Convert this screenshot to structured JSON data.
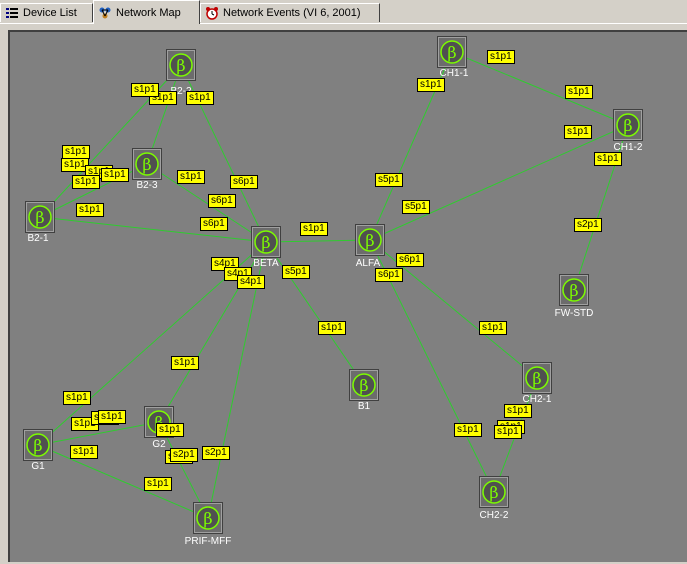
{
  "tabs": [
    {
      "label": "Device List",
      "icon": "list-icon",
      "active": false
    },
    {
      "label": "Network Map",
      "icon": "network-map-icon",
      "active": true
    },
    {
      "label": "Network Events (VI 6, 2001)",
      "icon": "alarm-clock-icon",
      "active": false
    }
  ],
  "colors": {
    "map_bg": "#808080",
    "link": "#2ecc2e",
    "port_bg": "#ffff00",
    "node_glyph": "#7CFC00"
  },
  "nodes": [
    {
      "id": "B2-2",
      "label": "B2-2"
    },
    {
      "id": "B2-3",
      "label": "B2-3"
    },
    {
      "id": "B2-1",
      "label": "B2-1"
    },
    {
      "id": "BETA",
      "label": "BETA"
    },
    {
      "id": "ALFA",
      "label": "ALFA"
    },
    {
      "id": "CH1-1",
      "label": "CH1-1"
    },
    {
      "id": "CH1-2",
      "label": "CH1-2"
    },
    {
      "id": "FW-STD",
      "label": "FW-STD"
    },
    {
      "id": "B1",
      "label": "B1"
    },
    {
      "id": "CH2-1",
      "label": "CH2-1"
    },
    {
      "id": "CH2-2",
      "label": "CH2-2"
    },
    {
      "id": "G1",
      "label": "G1"
    },
    {
      "id": "G2",
      "label": "G2"
    },
    {
      "id": "PRIF-MFF",
      "label": "PRIF-MFF"
    }
  ],
  "links": [
    [
      "B2-2",
      "B2-1"
    ],
    [
      "B2-2",
      "B2-3"
    ],
    [
      "B2-2",
      "BETA"
    ],
    [
      "B2-1",
      "B2-3"
    ],
    [
      "B2-1",
      "BETA"
    ],
    [
      "B2-3",
      "BETA"
    ],
    [
      "BETA",
      "ALFA"
    ],
    [
      "BETA",
      "B1"
    ],
    [
      "BETA",
      "G1"
    ],
    [
      "BETA",
      "G2"
    ],
    [
      "BETA",
      "PRIF-MFF"
    ],
    [
      "ALFA",
      "CH1-1"
    ],
    [
      "ALFA",
      "CH1-2"
    ],
    [
      "ALFA",
      "CH2-1"
    ],
    [
      "ALFA",
      "CH2-2"
    ],
    [
      "CH1-1",
      "CH1-2"
    ],
    [
      "CH1-2",
      "FW-STD"
    ],
    [
      "CH2-1",
      "CH2-2"
    ],
    [
      "G1",
      "G2"
    ],
    [
      "G1",
      "PRIF-MFF"
    ],
    [
      "G2",
      "PRIF-MFF"
    ]
  ],
  "ports": [
    "s1p1",
    "s1p1",
    "s1p1",
    "s1p1",
    "s1p1",
    "s1p1",
    "s1p1",
    "s1p1",
    "s1p1",
    "s6p1",
    "s6p1",
    "s6p1",
    "s1p1",
    "s4p1",
    "s4p1",
    "s4p1",
    "s5p1",
    "s1p1",
    "s5p1",
    "s5p1",
    "s1p1",
    "s1p1",
    "s1p1",
    "s1p1",
    "s1p1",
    "s2p1",
    "s1p1",
    "s6p1",
    "s6p1",
    "s1p1",
    "s1p1",
    "s1p1",
    "s1p1",
    "s1p1",
    "s1p1",
    "s1p1",
    "s1p1",
    "s1p1",
    "s1p1",
    "s1p1",
    "s1p1",
    "s2p1",
    "s2p1",
    "s2p1",
    "s1p1",
    "s1p1",
    "s1p1"
  ]
}
